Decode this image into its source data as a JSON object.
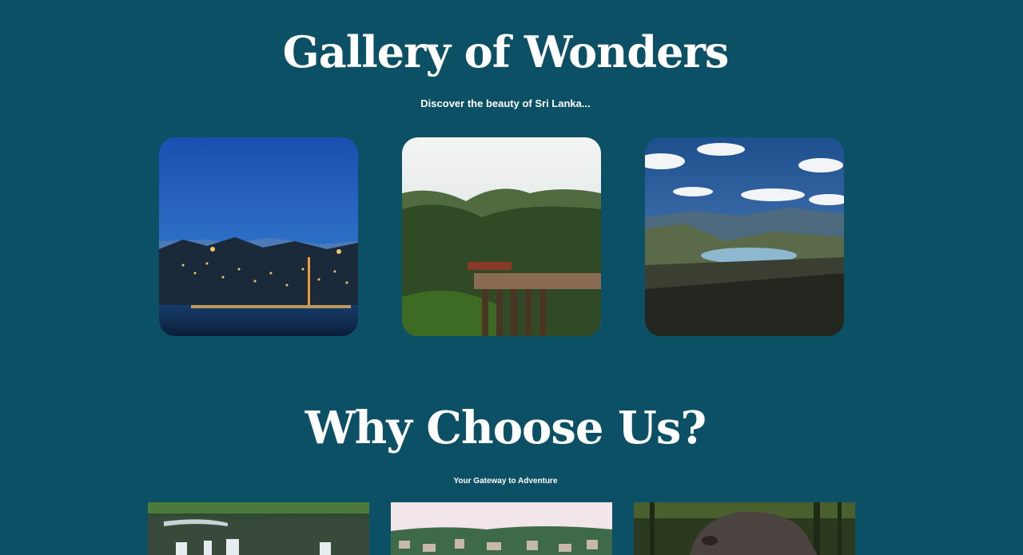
{
  "gallery": {
    "title": "Gallery of Wonders",
    "subtitle": "Discover the beauty of Sri Lanka...",
    "images": [
      {
        "name": "kandy-lake-night-image"
      },
      {
        "name": "nine-arch-bridge-image"
      },
      {
        "name": "mountain-reservoir-view-image"
      }
    ]
  },
  "why_choose_us": {
    "title": "Why Choose Us?",
    "subtitle": "Your Gateway to Adventure",
    "features": [
      {
        "name": "waterfall-feature-image"
      },
      {
        "name": "town-view-feature-image"
      },
      {
        "name": "elephant-feature-image"
      }
    ]
  },
  "colors": {
    "background": "#0b5064",
    "text": "#ffffff"
  }
}
